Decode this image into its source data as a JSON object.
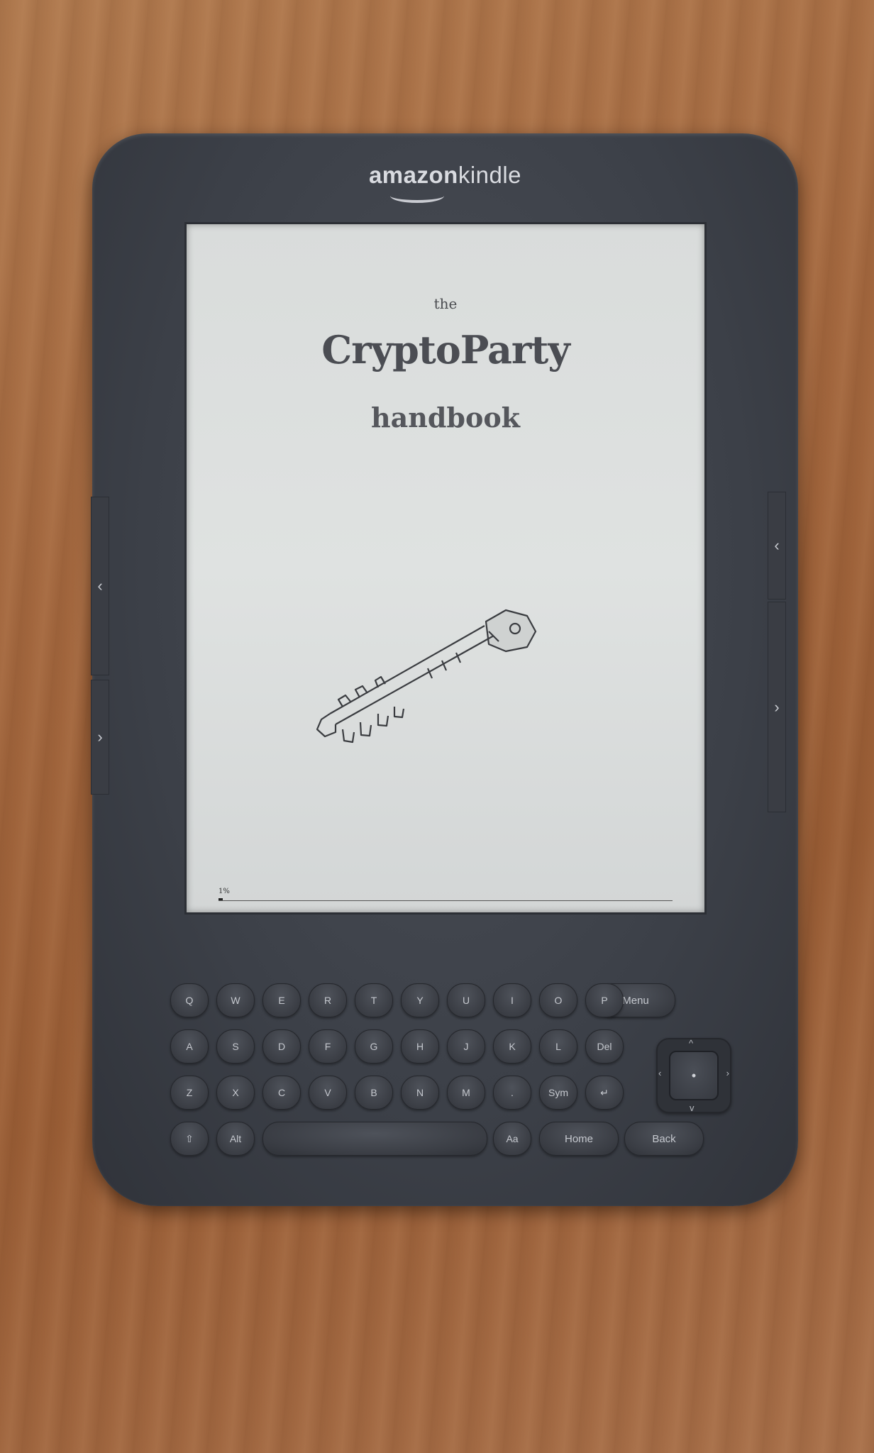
{
  "device": {
    "brand_part1": "amazon",
    "brand_part2": "kindle"
  },
  "book": {
    "the": "the",
    "title": "CryptoParty",
    "subtitle": "handbook",
    "progress_label": "1%",
    "progress_fraction": 0.01
  },
  "side_buttons": {
    "left_prev": "‹",
    "left_next": "›",
    "right_prev": "‹",
    "right_next": "›"
  },
  "keyboard": {
    "row1": [
      "Q",
      "W",
      "E",
      "R",
      "T",
      "Y",
      "U",
      "I",
      "O",
      "P"
    ],
    "row2": [
      "A",
      "S",
      "D",
      "F",
      "G",
      "H",
      "J",
      "K",
      "L",
      "Del"
    ],
    "row3": [
      "Z",
      "X",
      "C",
      "V",
      "B",
      "N",
      "M",
      ".",
      "Sym",
      "↵"
    ],
    "shift": "⇧",
    "alt": "Alt",
    "font": "Aa",
    "menu": "Menu",
    "home": "Home",
    "back": "Back",
    "dpad_center": "•"
  },
  "colors": {
    "device_body": "#3c4048",
    "screen": "#dfe2e1",
    "table": "#a4683f"
  }
}
